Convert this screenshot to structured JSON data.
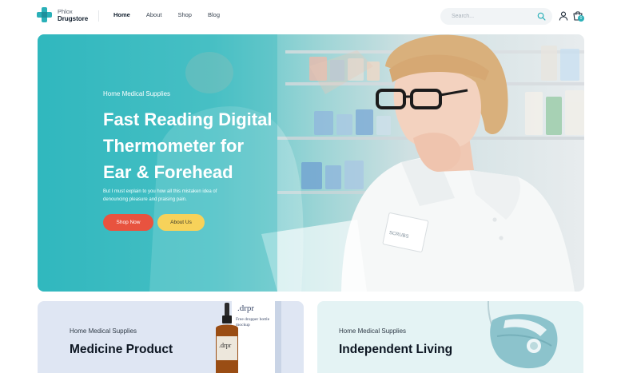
{
  "brand": {
    "line1": "Phlox",
    "line2": "Drugstore"
  },
  "nav": [
    {
      "label": "Home",
      "active": true
    },
    {
      "label": "About",
      "active": false
    },
    {
      "label": "Shop",
      "active": false
    },
    {
      "label": "Blog",
      "active": false
    }
  ],
  "search": {
    "placeholder": "Search..."
  },
  "cart": {
    "count": "0"
  },
  "hero": {
    "subtitle": "Home Medical Supplies",
    "title_lines": [
      "Fast Reading Digital",
      "Thermometer for",
      "Ear & Forehead"
    ],
    "description": "But I must explain to you how all this mistaken idea of denouncing pleasure and praising pain.",
    "primary_button": "Shop Now",
    "secondary_button": "About Us",
    "badge_text": "SCRUBS"
  },
  "cards": [
    {
      "subtitle": "Home Medical Supplies",
      "title": "Medicine Product",
      "box_brand": ".drpr",
      "box_text": "Free dropper bottle mockup",
      "bottle_label": ".drpr"
    },
    {
      "subtitle": "Home Medical Supplies",
      "title": "Independent Living"
    }
  ],
  "colors": {
    "accent": "#2ab0b8",
    "primary_button": "#e8533f",
    "secondary_button": "#f7d25a"
  },
  "icons": [
    "plus-logo-icon",
    "search-icon",
    "user-icon",
    "cart-icon"
  ]
}
